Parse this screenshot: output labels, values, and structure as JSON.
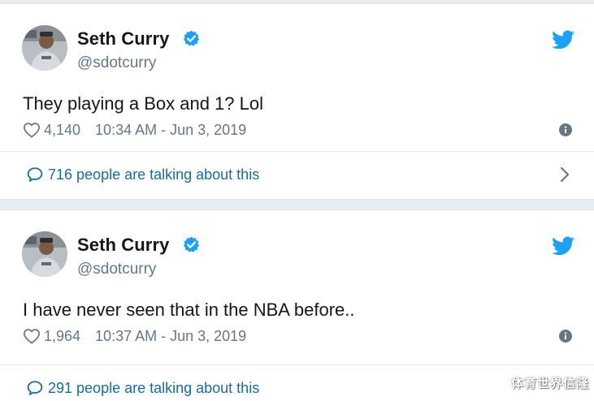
{
  "tweets": [
    {
      "author_name": "Seth Curry",
      "handle": "@sdotcurry",
      "text": "They playing a Box and 1? Lol",
      "likes": "4,140",
      "timestamp": "10:34 AM - Jun 3, 2019",
      "talking": "716 people are talking about this"
    },
    {
      "author_name": "Seth Curry",
      "handle": "@sdotcurry",
      "text": "I have never seen that in the NBA before..",
      "likes": "1,964",
      "timestamp": "10:37 AM - Jun 3, 2019",
      "talking": "291 people are talking about this"
    }
  ],
  "watermark": "体育世界信隆",
  "colors": {
    "twitter_blue": "#1da1f2",
    "verified_blue": "#1da1f2",
    "link_blue": "#1b6a9e",
    "text_dark": "#14171a",
    "text_gray": "#657786",
    "background": "#e6ecf0"
  },
  "icons": [
    "verified-badge-icon",
    "twitter-bird-icon",
    "heart-icon",
    "info-icon",
    "speech-bubble-icon",
    "chevron-right-icon"
  ]
}
